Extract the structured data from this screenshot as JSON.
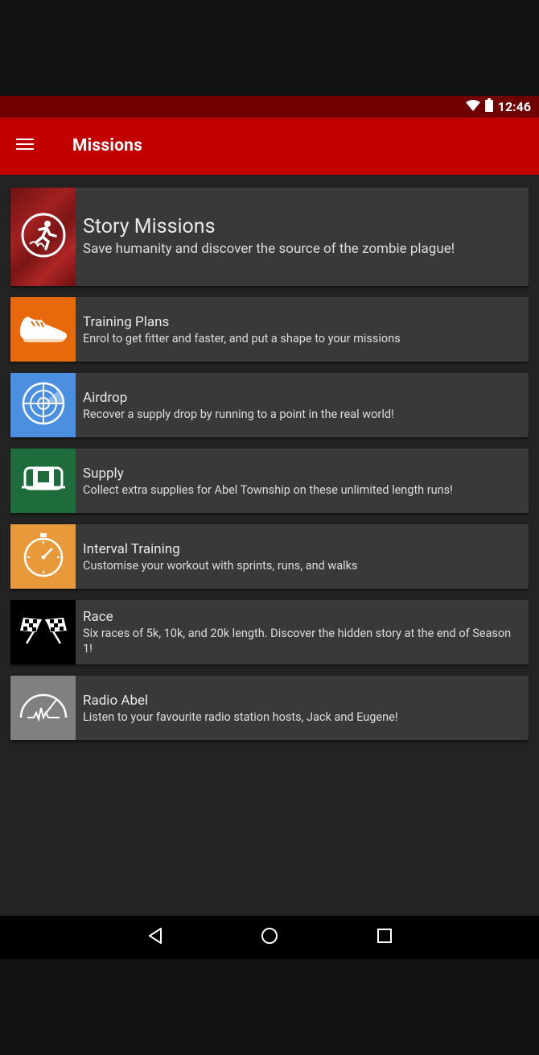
{
  "status_bar": {
    "time": "12:46",
    "icons": [
      "wifi-icon",
      "battery-icon"
    ]
  },
  "app_bar": {
    "title": "Missions",
    "menu_icon": "hamburger-menu-icon"
  },
  "missions": [
    {
      "title": "Story Missions",
      "description": "Save humanity and discover the source of the zombie plague!",
      "icon": "running-figure-icon",
      "color": "#8e1a1a"
    },
    {
      "title": "Training Plans",
      "description": "Enrol to get fitter and faster, and put a shape to your missions",
      "icon": "shoe-icon",
      "color": "#e8690b"
    },
    {
      "title": "Airdrop",
      "description": "Recover a supply drop by running to a point in the real world!",
      "icon": "radar-icon",
      "color": "#4a8fe0"
    },
    {
      "title": "Supply",
      "description": "Collect extra supplies for Abel Township on these unlimited length runs!",
      "icon": "supply-crate-icon",
      "color": "#1e6b3c"
    },
    {
      "title": "Interval Training",
      "description": "Customise your workout with sprints, runs, and walks",
      "icon": "stopwatch-icon",
      "color": "#e89a3a"
    },
    {
      "title": "Race",
      "description": "Six races of 5k, 10k, and 20k length. Discover the hidden story at the end of Season 1!",
      "icon": "checkered-flags-icon",
      "color": "#000000"
    },
    {
      "title": "Radio Abel",
      "description": "Listen to your favourite radio station hosts, Jack and Eugene!",
      "icon": "radio-signal-icon",
      "color": "#808080"
    }
  ],
  "nav_bar": {
    "icons": [
      "back-icon",
      "home-icon",
      "recents-icon"
    ]
  },
  "colors": {
    "status_bar": "#700000",
    "app_bar": "#c20000",
    "background": "#232323",
    "card": "#393939"
  }
}
